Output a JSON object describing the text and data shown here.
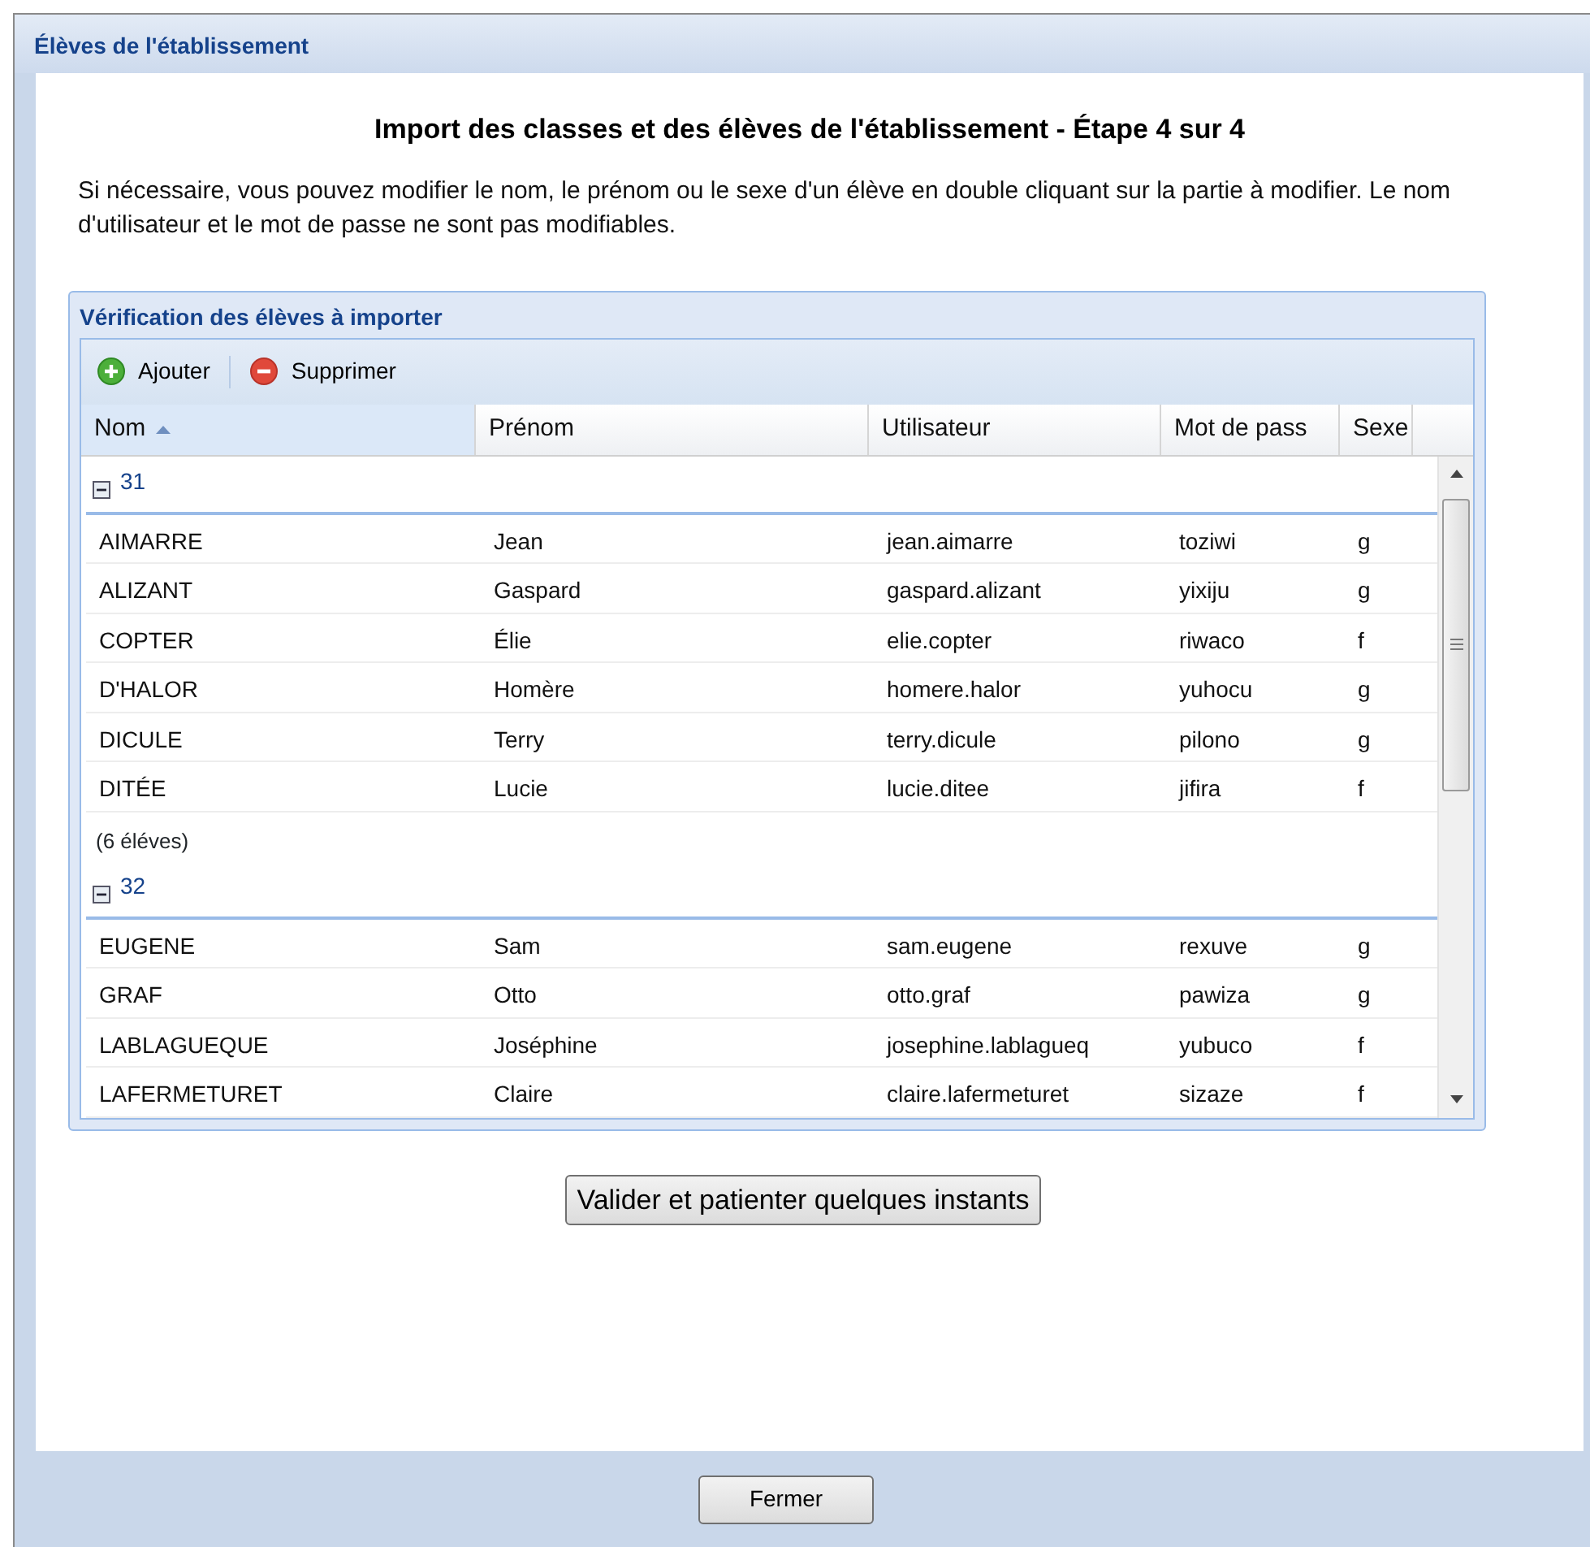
{
  "window": {
    "title": "Élèves de l'établissement"
  },
  "heading": "Import des classes et des élèves de l'établissement - Étape 4 sur 4",
  "instructions": "Si nécessaire, vous pouvez modifier le nom, le prénom ou le sexe d'un élève en double cliquant sur la partie à modifier. Le nom d'utilisateur et le mot de passe ne sont pas modifiables.",
  "panel": {
    "title": "Vérification des élèves à importer",
    "toolbar": [
      {
        "kind": "add",
        "label": "Ajouter"
      },
      {
        "kind": "remove",
        "label": "Supprimer"
      }
    ],
    "columns": [
      {
        "label": "Nom",
        "sorted": true
      },
      {
        "label": "Prénom",
        "sorted": false
      },
      {
        "label": "Utilisateur",
        "sorted": false
      },
      {
        "label": "Mot de pass",
        "sorted": false
      },
      {
        "label": "Sexe",
        "sorted": false
      }
    ],
    "groups": [
      {
        "label": "31",
        "expanded": true,
        "rows": [
          [
            "AIMARRE",
            "Jean",
            "jean.aimarre",
            "toziwi",
            "g"
          ],
          [
            "ALIZANT",
            "Gaspard",
            "gaspard.alizant",
            "yixiju",
            "g"
          ],
          [
            "COPTER",
            "Élie",
            "elie.copter",
            "riwaco",
            "f"
          ],
          [
            "D'HALOR",
            "Homère",
            "homere.halor",
            "yuhocu",
            "g"
          ],
          [
            "DICULE",
            "Terry",
            "terry.dicule",
            "pilono",
            "g"
          ],
          [
            "DITÉE",
            "Lucie",
            "lucie.ditee",
            "jifira",
            "f"
          ]
        ],
        "count": "(6 éléves)"
      },
      {
        "label": "32",
        "expanded": true,
        "rows": [
          [
            "EUGENE",
            "Sam",
            "sam.eugene",
            "rexuve",
            "g"
          ],
          [
            "GRAF",
            "Otto",
            "otto.graf",
            "pawiza",
            "g"
          ],
          [
            "LABLAGUEQUE",
            "Joséphine",
            "josephine.lablagueq",
            "yubuco",
            "f"
          ],
          [
            "LAFERMETURET",
            "Claire",
            "claire.lafermeturet",
            "sizaze",
            "f"
          ]
        ]
      }
    ]
  },
  "submit_button": "Valider et patienter quelques instants",
  "close_button": "Fermer"
}
